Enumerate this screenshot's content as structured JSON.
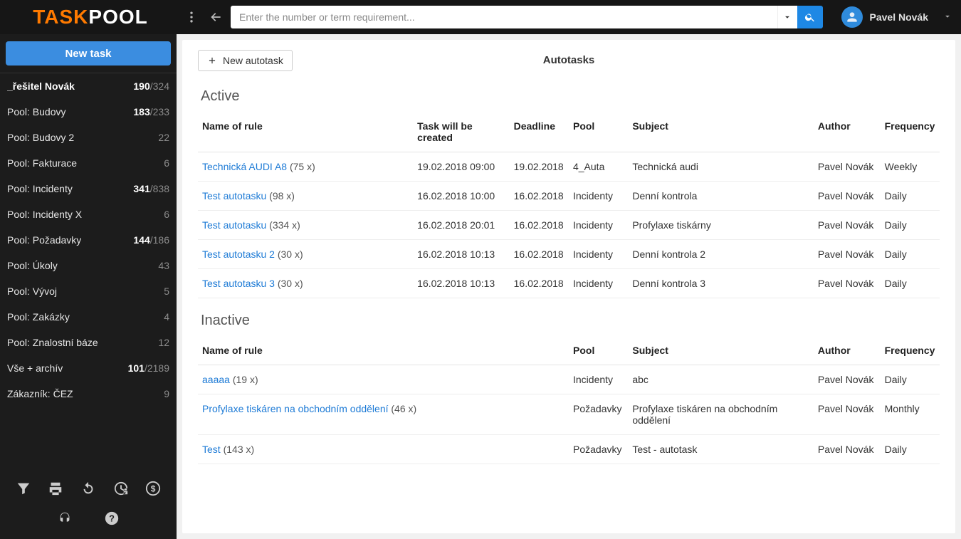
{
  "app": {
    "logo_task": "TASK",
    "logo_pool": "POOL"
  },
  "search": {
    "placeholder": "Enter the number or term requirement..."
  },
  "user": {
    "name": "Pavel Novák"
  },
  "sidebar": {
    "new_task_label": "New task",
    "items": [
      {
        "label": "_řešitel Novák",
        "count_bold": "190",
        "count_gray": "/324",
        "first": true
      },
      {
        "label": "Pool: Budovy",
        "count_bold": "183",
        "count_gray": "/233"
      },
      {
        "label": "Pool: Budovy 2",
        "count_bold": "",
        "count_gray": "22"
      },
      {
        "label": "Pool: Fakturace",
        "count_bold": "",
        "count_gray": "6"
      },
      {
        "label": "Pool: Incidenty",
        "count_bold": "341",
        "count_gray": "/838"
      },
      {
        "label": "Pool: Incidenty X",
        "count_bold": "",
        "count_gray": "6"
      },
      {
        "label": "Pool: Požadavky",
        "count_bold": "144",
        "count_gray": "/186"
      },
      {
        "label": "Pool: Úkoly",
        "count_bold": "",
        "count_gray": "43"
      },
      {
        "label": "Pool: Vývoj",
        "count_bold": "",
        "count_gray": "5"
      },
      {
        "label": "Pool: Zakázky",
        "count_bold": "",
        "count_gray": "4"
      },
      {
        "label": "Pool: Znalostní báze",
        "count_bold": "",
        "count_gray": "12"
      },
      {
        "label": "Vše + archív",
        "count_bold": "101",
        "count_gray": "/2189"
      },
      {
        "label": "Zákazník: ČEZ",
        "count_bold": "",
        "count_gray": "9"
      }
    ]
  },
  "panel": {
    "title": "Autotasks",
    "new_autotask_label": "New autotask",
    "active_title": "Active",
    "inactive_title": "Inactive",
    "columns_active": {
      "name": "Name of rule",
      "created": "Task will be created",
      "deadline": "Deadline",
      "pool": "Pool",
      "subject": "Subject",
      "author": "Author",
      "frequency": "Frequency"
    },
    "columns_inactive": {
      "name": "Name of rule",
      "pool": "Pool",
      "subject": "Subject",
      "author": "Author",
      "frequency": "Frequency"
    },
    "active_rows": [
      {
        "name": "Technická AUDI A8",
        "count": "(75 x)",
        "created": "19.02.2018 09:00",
        "deadline": "19.02.2018",
        "pool": "4_Auta",
        "subject": "Technická audi",
        "author": "Pavel Novák",
        "frequency": "Weekly"
      },
      {
        "name": "Test autotasku",
        "count": "(98 x)",
        "created": "16.02.2018 10:00",
        "deadline": "16.02.2018",
        "pool": "Incidenty",
        "subject": "Denní kontrola",
        "author": "Pavel Novák",
        "frequency": "Daily"
      },
      {
        "name": "Test autotasku",
        "count": "(334 x)",
        "created": "16.02.2018 20:01",
        "deadline": "16.02.2018",
        "pool": "Incidenty",
        "subject": "Profylaxe tiskárny",
        "author": "Pavel Novák",
        "frequency": "Daily"
      },
      {
        "name": "Test autotasku 2",
        "count": "(30 x)",
        "created": "16.02.2018 10:13",
        "deadline": "16.02.2018",
        "pool": "Incidenty",
        "subject": "Denní kontrola 2",
        "author": "Pavel Novák",
        "frequency": "Daily"
      },
      {
        "name": "Test autotasku 3",
        "count": "(30 x)",
        "created": "16.02.2018 10:13",
        "deadline": "16.02.2018",
        "pool": "Incidenty",
        "subject": "Denní kontrola 3",
        "author": "Pavel Novák",
        "frequency": "Daily"
      }
    ],
    "inactive_rows": [
      {
        "name": "aaaaa",
        "count": "(19 x)",
        "pool": "Incidenty",
        "subject": "abc",
        "author": "Pavel Novák",
        "frequency": "Daily"
      },
      {
        "name": "Profylaxe tiskáren na obchodním oddělení",
        "count": "(46 x)",
        "pool": "Požadavky",
        "subject": "Profylaxe tiskáren na obchodním oddělení",
        "author": "Pavel Novák",
        "frequency": "Monthly"
      },
      {
        "name": "Test",
        "count": "(143 x)",
        "pool": "Požadavky",
        "subject": "Test - autotask",
        "author": "Pavel Novák",
        "frequency": "Daily"
      }
    ]
  }
}
